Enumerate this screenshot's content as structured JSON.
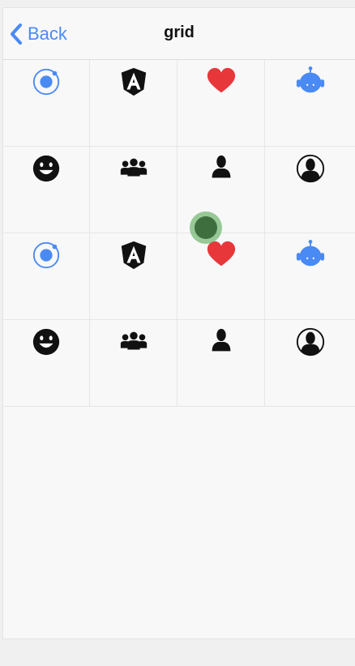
{
  "navbar": {
    "back_label": "Back",
    "title": "grid"
  },
  "colors": {
    "accent": "#4a8af4",
    "heart": "#e8373a",
    "icon_dark": "#111111"
  },
  "grid": {
    "rows": [
      [
        "ionic-icon",
        "angular-icon",
        "heart-icon",
        "android-icon"
      ],
      [
        "happy-face-icon",
        "people-group-icon",
        "person-icon",
        "person-circle-icon"
      ],
      [
        "ionic-icon",
        "angular-icon",
        "heart-icon",
        "android-icon"
      ],
      [
        "happy-face-icon",
        "people-group-icon",
        "person-icon",
        "person-circle-icon"
      ]
    ]
  }
}
